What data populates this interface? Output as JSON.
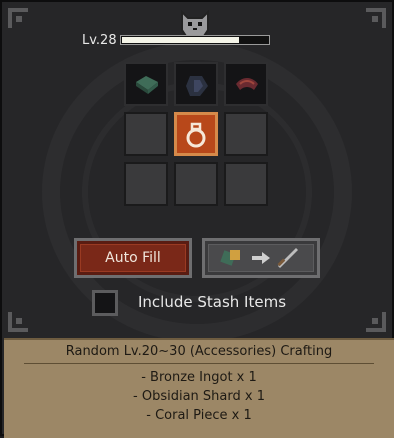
{
  "player": {
    "level_label": "Lv.28",
    "xp_progress": 0.8
  },
  "slots": {
    "top": [
      "bronze-ingot-icon",
      "obsidian-shard-icon",
      "coral-piece-icon"
    ],
    "selected": "ring-icon"
  },
  "buttons": {
    "auto_fill": "Auto Fill",
    "craft_icons": [
      "materials-icon",
      "arrow-right-icon",
      "sword-icon"
    ]
  },
  "stash": {
    "label": "Include Stash Items",
    "checked": false
  },
  "recipe": {
    "title": "Random Lv.20~30 (Accessories) Crafting",
    "materials": [
      "- Bronze Ingot x 1",
      "- Obsidian Shard x 1",
      "- Coral Piece x 1"
    ]
  },
  "colors": {
    "accent": "#b8481a",
    "info_bg": "#9c8766",
    "button_red": "#7a2818"
  }
}
